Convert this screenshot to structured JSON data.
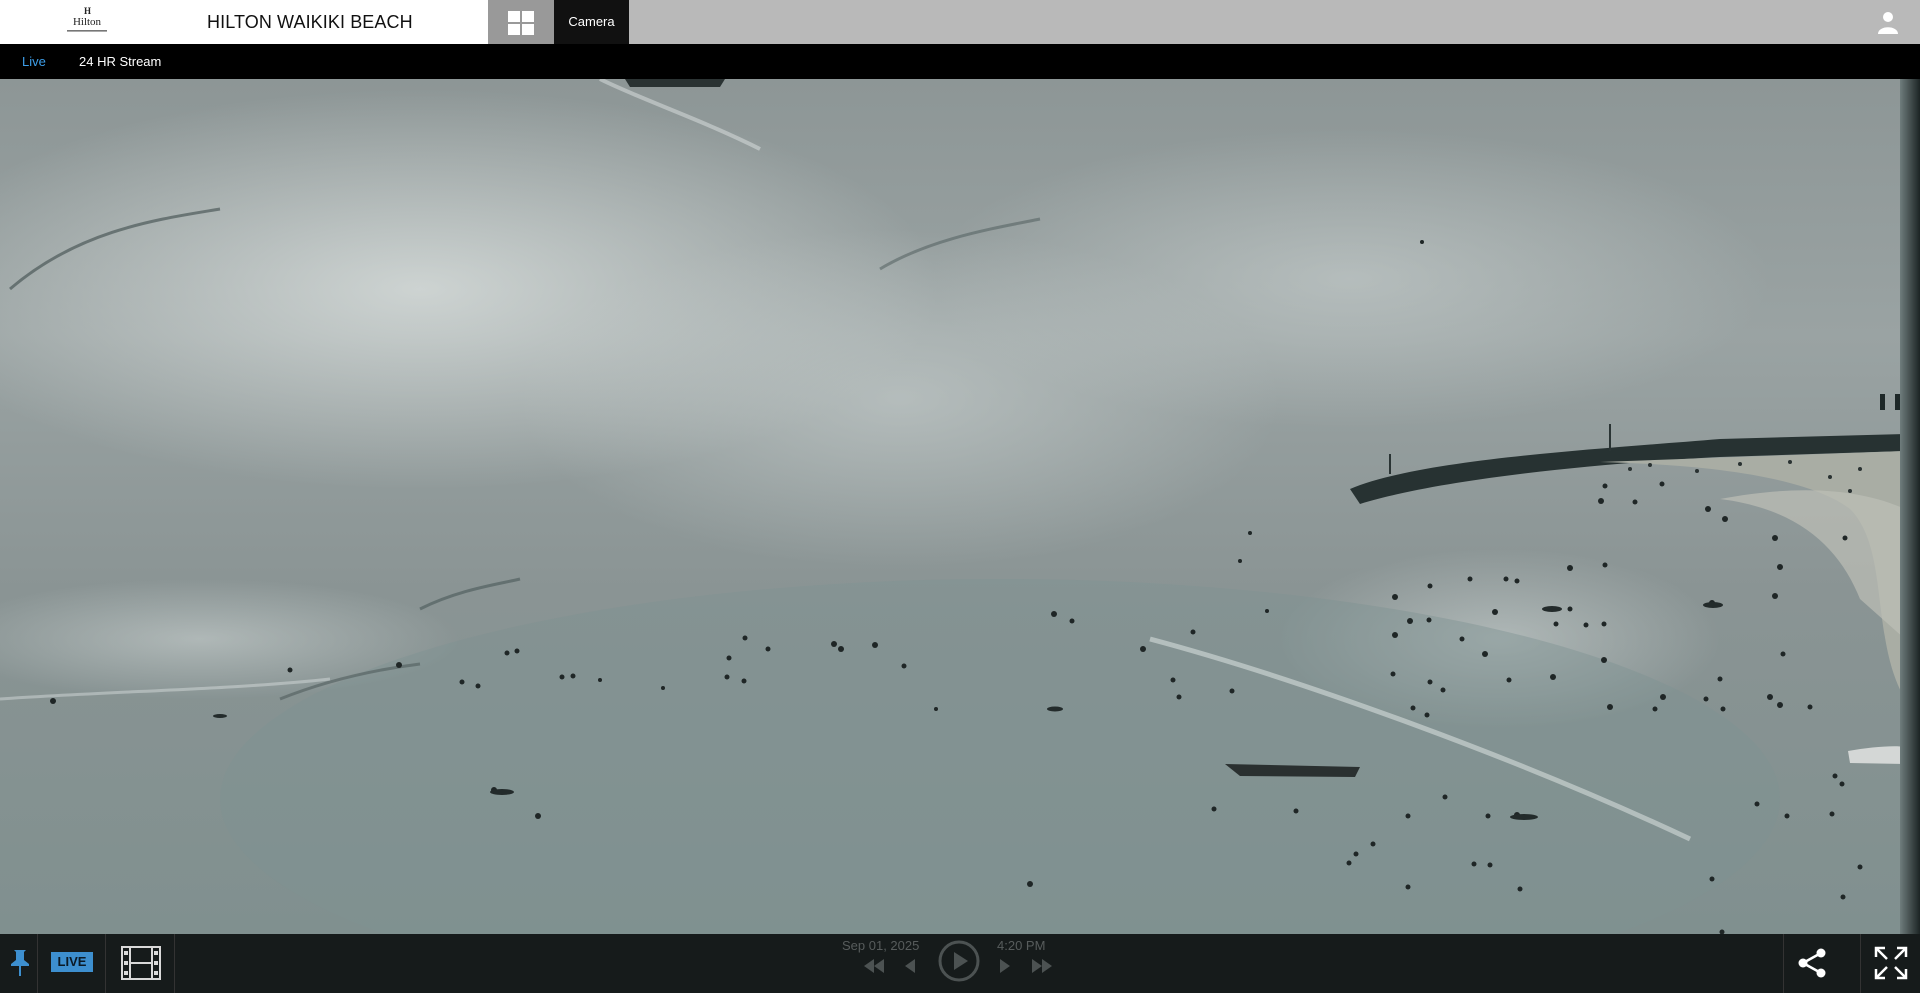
{
  "header": {
    "logo_mark": "H",
    "logo_word": "Hilton",
    "title": "HILTON WAIKIKI BEACH",
    "grid_icon": "grid-icon",
    "tab_label": "Camera",
    "user_icon": "user-icon"
  },
  "subnav": {
    "items": [
      {
        "label": "Live",
        "active": true
      },
      {
        "label": "24 HR Stream",
        "active": false
      }
    ]
  },
  "player": {
    "live_label": "LIVE",
    "date": "Sep 01, 2025",
    "time": "4:20 PM",
    "icons": [
      "pin-icon",
      "film-icon",
      "skip-back-icon",
      "step-back-icon",
      "play-icon",
      "step-forward-icon",
      "skip-forward-icon",
      "share-icon",
      "fullscreen-icon"
    ]
  },
  "colors": {
    "accent": "#3d9ee8",
    "live_badge": "#3d8fcf",
    "header_bg": "#b9b9b9",
    "player_bg": "#161b1b"
  }
}
